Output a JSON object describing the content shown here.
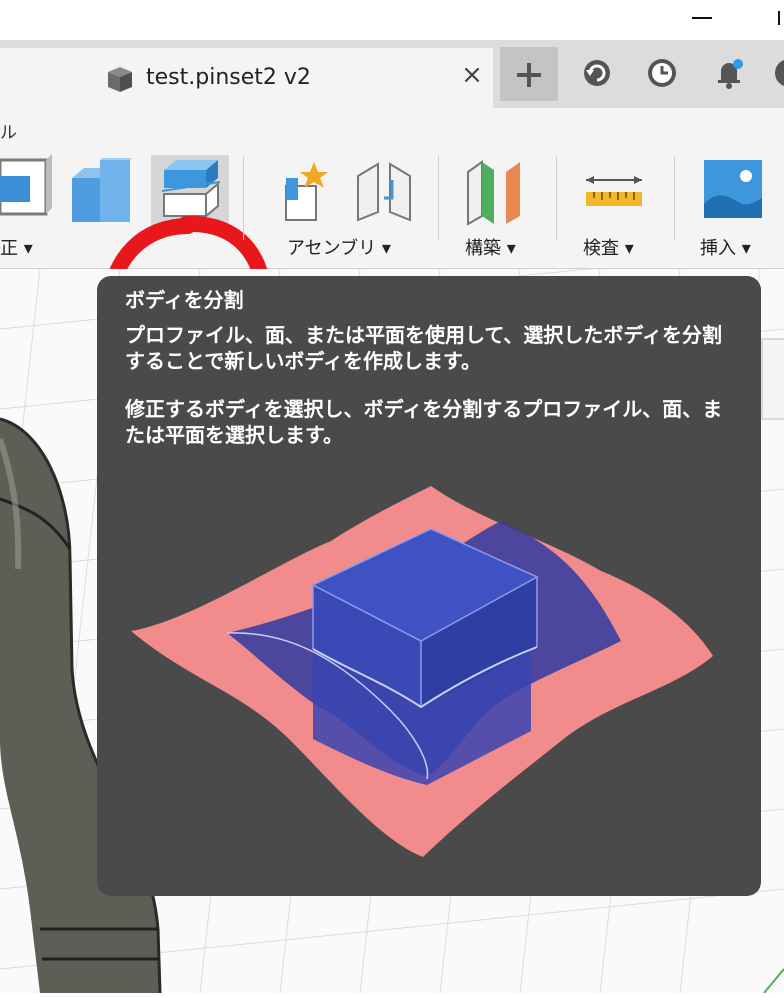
{
  "window": {
    "minimize_icon": "minimize-icon",
    "maximize_icon": "maximize-icon"
  },
  "tab": {
    "title": "test.pinset2 v2",
    "close": "×",
    "icon": "cube-icon"
  },
  "tabbar_icons": [
    "plus-icon",
    "refresh-icon",
    "clock-icon",
    "bell-icon"
  ],
  "ribbon": {
    "workspace_fragment": "ル",
    "groups": [
      {
        "label": "正 ▾",
        "icon": "modify-icon"
      },
      {
        "label": "アセンブリ ▾",
        "icon": "assemble-icon"
      },
      {
        "label": "構築 ▾",
        "icon": "construct-icon"
      },
      {
        "label": "検査 ▾",
        "icon": "inspect-icon"
      },
      {
        "label": "挿入 ▾",
        "icon": "insert-icon"
      }
    ],
    "highlighted_tool": "split-body-icon",
    "annotation_color": "#e8171c"
  },
  "tooltip": {
    "title": "ボディを分割",
    "description_1": "プロファイル、面、または平面を使用して、選択したボディを分割することで新しいボディを作成します。",
    "description_2": "修正するボディを選択し、ボディを分割するプロファイル、面、または平面を選択します。",
    "illustration": "split-body-illustration",
    "colors": {
      "background": "#4a4a4a",
      "surface": "#f28b8b",
      "body": "#3a4aad"
    }
  }
}
